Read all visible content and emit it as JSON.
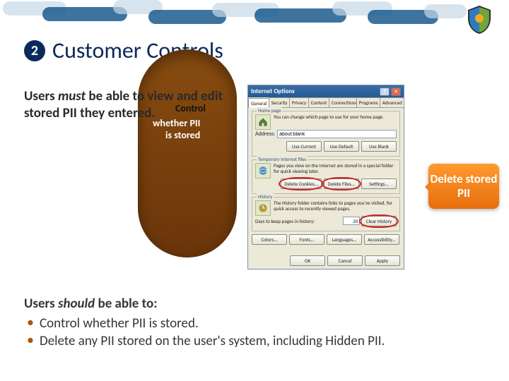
{
  "heading": {
    "number": "2",
    "text": "Customer Controls"
  },
  "must_sentence_html": "Users <em>must</em> be able to view and edit stored PII they entered.",
  "pill_overlap": {
    "l1": "Control",
    "l2": "whether PII",
    "l3": "is stored"
  },
  "callout": "Delete stored PII",
  "should": {
    "lead_html": "Users <em>should</em> be able to:",
    "items": [
      "Control whether PII is stored.",
      "Delete any PII stored on the user's system, including Hidden PII."
    ]
  },
  "dialog": {
    "title": "Internet Options",
    "tabs": [
      "General",
      "Security",
      "Privacy",
      "Content",
      "Connections",
      "Programs",
      "Advanced"
    ],
    "homepage": {
      "label": "Home page",
      "desc": "You can change which page to use for your home page.",
      "addr_label": "Address:",
      "addr_value": "about:blank",
      "buttons": [
        "Use Current",
        "Use Default",
        "Use Blank"
      ]
    },
    "tif": {
      "label": "Temporary Internet files",
      "desc": "Pages you view on the Internet are stored in a special folder for quick viewing later.",
      "buttons": [
        "Delete Cookies...",
        "Delete Files...",
        "Settings..."
      ]
    },
    "history": {
      "label": "History",
      "desc": "The History folder contains links to pages you've visited, for quick access to recently viewed pages.",
      "days_label": "Days to keep pages in history:",
      "days_value": "20",
      "clear": "Clear History"
    },
    "misc_buttons": [
      "Colors...",
      "Fonts...",
      "Languages...",
      "Accessibility..."
    ],
    "footer": [
      "OK",
      "Cancel",
      "Apply"
    ]
  }
}
